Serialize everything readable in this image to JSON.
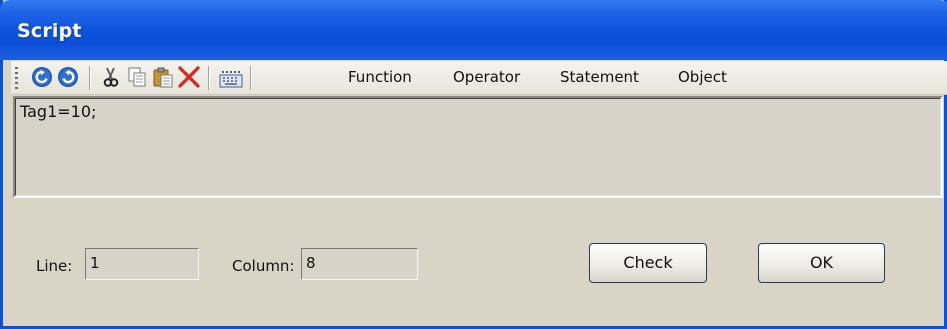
{
  "window": {
    "title": "Script"
  },
  "toolbar": {
    "icons": [
      "undo-icon",
      "redo-icon",
      "cut-icon",
      "copy-icon",
      "paste-icon",
      "delete-icon",
      "keyboard-icon"
    ],
    "menus": [
      "Function",
      "Operator",
      "Statement",
      "Object"
    ]
  },
  "editor": {
    "text": "Tag1=10;"
  },
  "status": {
    "line_label": "Line:",
    "line_value": "1",
    "column_label": "Column:",
    "column_value": "8"
  },
  "buttons": {
    "check": "Check",
    "ok": "OK"
  },
  "colors": {
    "titlebar": "#0b4fd8",
    "window_bg": "#d8d4c6",
    "undo": "#1d55b3"
  }
}
